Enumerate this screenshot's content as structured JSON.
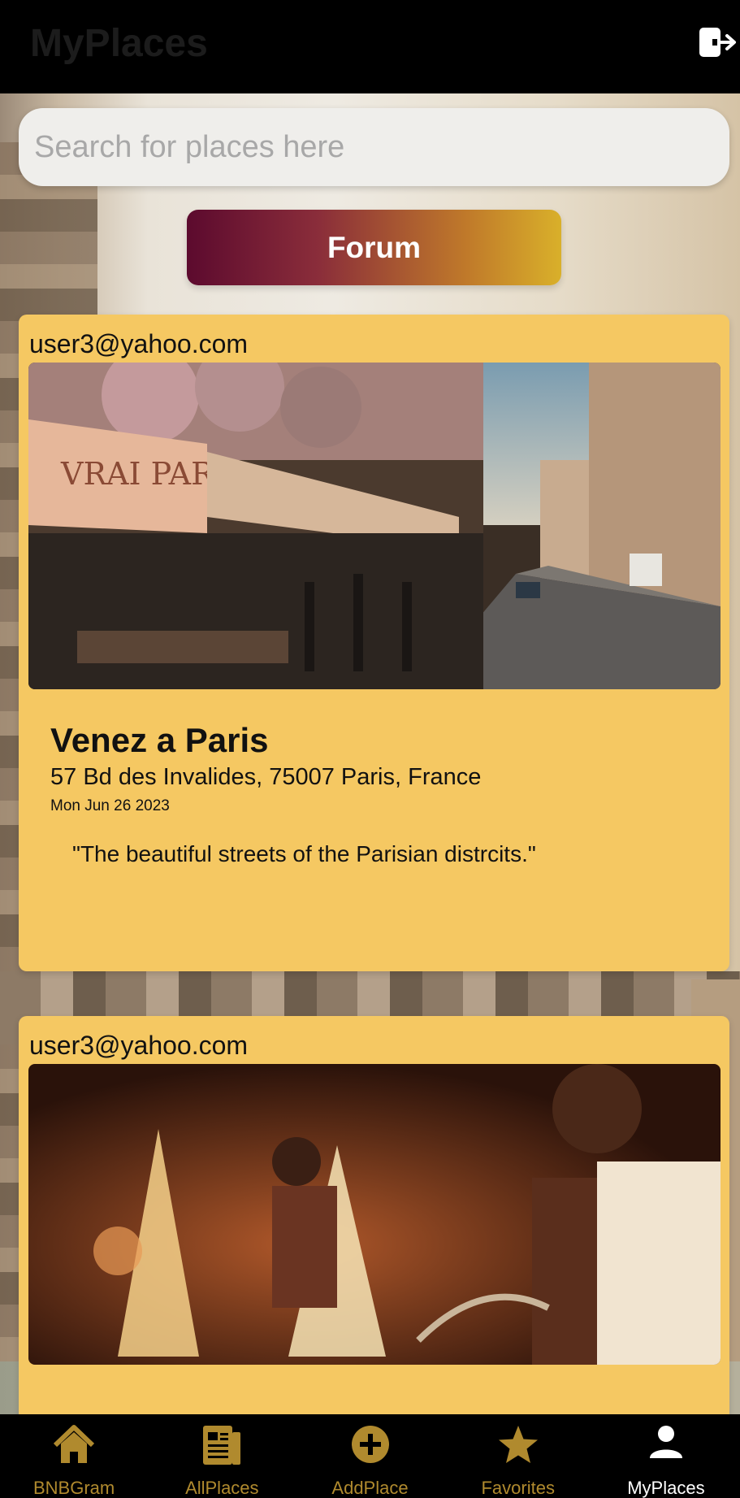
{
  "header": {
    "title": "MyPlaces",
    "logout_icon": "logout-icon"
  },
  "search": {
    "placeholder": "Search for places here",
    "value": ""
  },
  "forum_button": {
    "label": "Forum"
  },
  "posts": [
    {
      "user": "user3@yahoo.com",
      "title": "Venez a Paris",
      "address": "57 Bd des Invalides, 75007 Paris, France",
      "date": "Mon Jun 26 2023",
      "description": "\"The beautiful streets of the Parisian distrcits.\""
    },
    {
      "user": "user3@yahoo.com"
    }
  ],
  "nav": {
    "items": [
      {
        "label": "BNBGram",
        "icon": "home-icon",
        "active": false
      },
      {
        "label": "AllPlaces",
        "icon": "list-icon",
        "active": false
      },
      {
        "label": "AddPlace",
        "icon": "add-circle-icon",
        "active": false
      },
      {
        "label": "Favorites",
        "icon": "star-icon",
        "active": false
      },
      {
        "label": "MyPlaces",
        "icon": "person-icon",
        "active": true
      }
    ]
  },
  "colors": {
    "accent_gold": "#f5c862",
    "nav_inactive": "#b08a2e",
    "forum_gradient_start": "#5c0a2e",
    "forum_gradient_end": "#d9b02a"
  }
}
